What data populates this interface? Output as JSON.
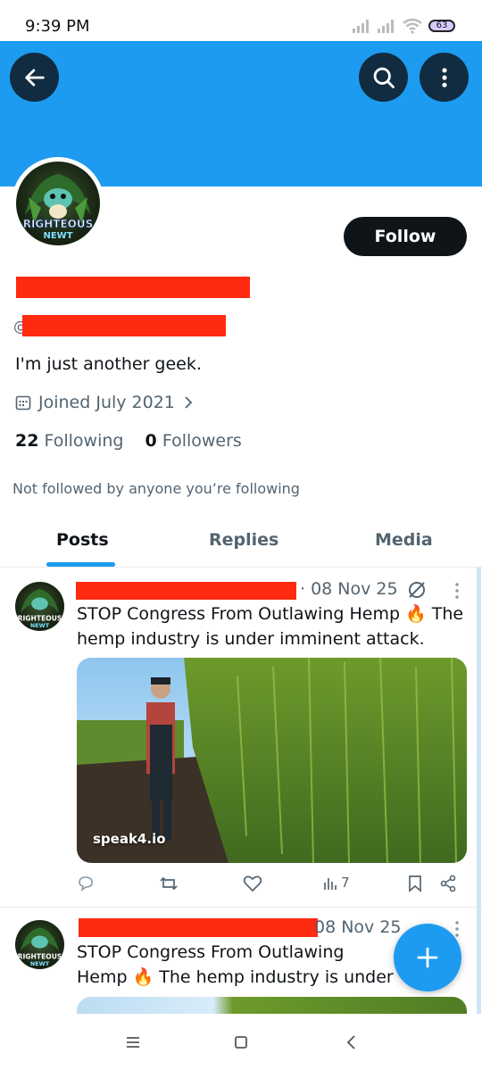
{
  "status_bar": {
    "time": "9:39 PM",
    "battery": "63"
  },
  "profile": {
    "handle_prefix": "@",
    "bio": "I'm just another geek.",
    "joined": "Joined July 2021",
    "following_count": "22",
    "following_label": "Following",
    "followers_count": "0",
    "followers_label": "Followers",
    "not_followed_note": "Not followed by anyone you’re following",
    "follow_button": "Follow",
    "avatar_text": "RIGHTEOUS NEWT"
  },
  "tabs": [
    {
      "label": "Posts",
      "active": true
    },
    {
      "label": "Replies",
      "active": false
    },
    {
      "label": "Media",
      "active": false
    }
  ],
  "posts": [
    {
      "date": "· 08 Nov 25",
      "text": "STOP Congress From Outlawing Hemp 🔥 The hemp industry is under imminent attack.",
      "image_label": "speak4.io",
      "views": "7"
    },
    {
      "date": "08 Nov 25",
      "text": "STOP Congress From Outlawing Hemp 🔥 The hemp industry is under imminent attack."
    }
  ],
  "colors": {
    "accent": "#1d9bf0",
    "redaction": "#ff2a10",
    "dark": "#0f1419",
    "muted": "#536471"
  }
}
